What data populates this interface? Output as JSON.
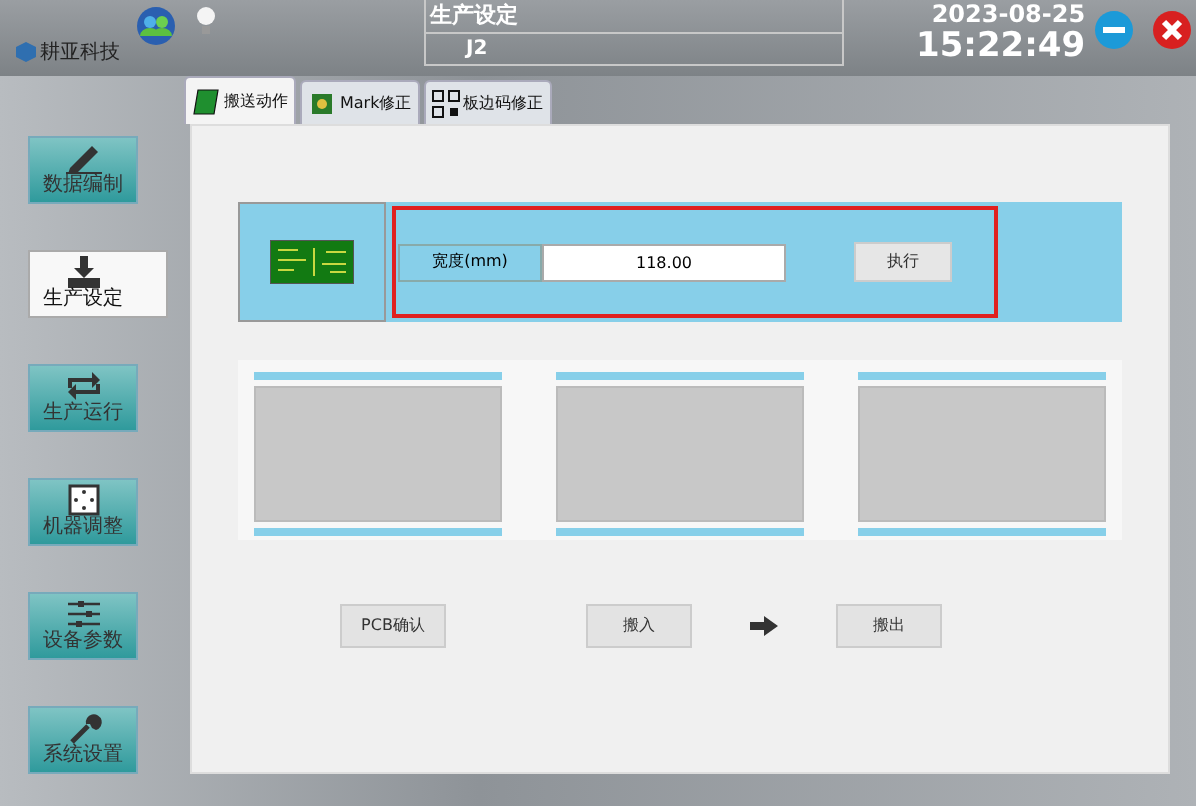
{
  "logo": {
    "text": "耕亚科技"
  },
  "header": {
    "title": "生产设定",
    "subtitle": "J2",
    "date": "2023-08-25",
    "time": "15:22:49"
  },
  "nav": [
    {
      "label": "数据编制",
      "selected": false
    },
    {
      "label": "生产设定",
      "selected": true
    },
    {
      "label": "生产运行",
      "selected": false
    },
    {
      "label": "机器调整",
      "selected": false
    },
    {
      "label": "设备参数",
      "selected": false
    },
    {
      "label": "系统设置",
      "selected": false
    }
  ],
  "tabs": [
    {
      "label": "搬送动作",
      "selected": true
    },
    {
      "label": "Mark修正",
      "selected": false
    },
    {
      "label": "板边码修正",
      "selected": false
    }
  ],
  "width_setting": {
    "label": "宽度(mm)",
    "value": "118.00",
    "button": "执行"
  },
  "slots": [
    {
      "kind": "empty"
    },
    {
      "kind": "empty"
    },
    {
      "kind": "empty"
    }
  ],
  "actions": [
    {
      "label": "PCB确认"
    },
    {
      "label": "搬入"
    },
    {
      "label": "搬出"
    }
  ]
}
